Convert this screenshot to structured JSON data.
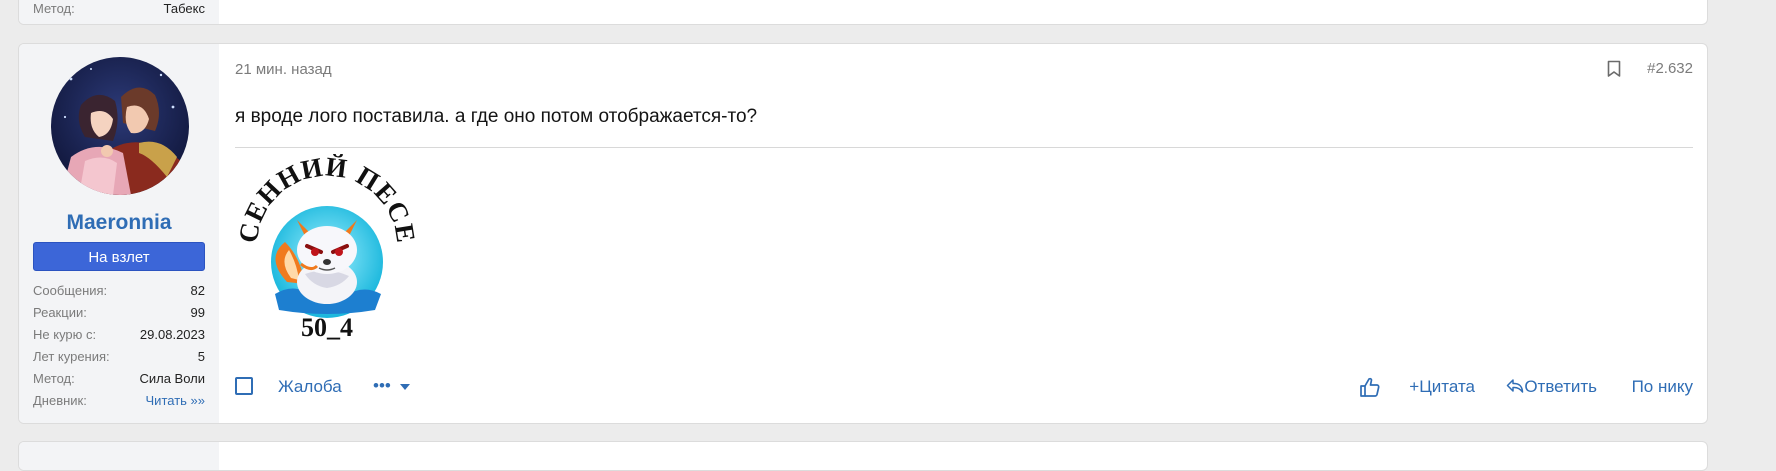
{
  "prev_post": {
    "stat_key": "Метод:",
    "stat_value": "Табекс"
  },
  "post": {
    "author": {
      "avatar_icon": "user-avatar-anime-couple",
      "username": "Maeronnia",
      "title_badge": "На взлет",
      "stats": [
        {
          "key": "Сообщения:",
          "value": "82"
        },
        {
          "key": "Реакции:",
          "value": "99"
        },
        {
          "key": "Не курю с:",
          "value": "29.08.2023"
        },
        {
          "key": "Лет курения:",
          "value": "5"
        },
        {
          "key": "Метод:",
          "value": "Сила Воли"
        },
        {
          "key": "Дневник:",
          "value": "Читать »»"
        }
      ]
    },
    "time": "21 мин. назад",
    "number": "#2.632",
    "message": "я вроде лого поставила. а где оно потом отображается-то?",
    "attachment": {
      "curved_text": "ОСЕННИЙ ПЕСЕЦ",
      "bottom_text": "50_4"
    },
    "actions": {
      "report": "Жалоба",
      "more_glyph": "•••",
      "quote": "+Цитата",
      "reply": "Ответить",
      "by_nick": "По нику"
    }
  },
  "colors": {
    "link": "#2f6db5",
    "badge_bg": "#3c66d8",
    "muted": "#7b7b7b",
    "page_bg": "#ececec"
  }
}
